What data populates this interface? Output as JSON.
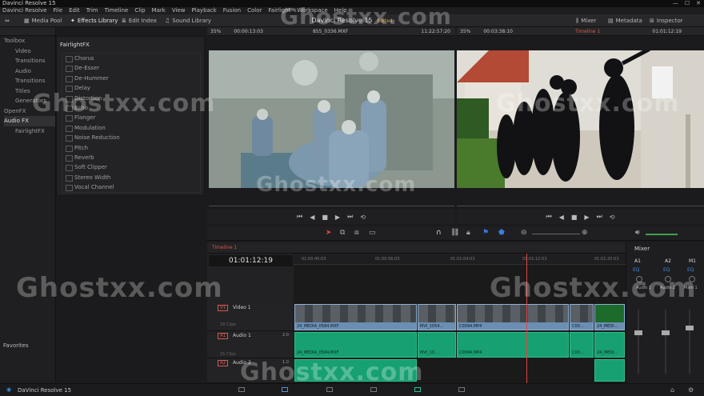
{
  "window": {
    "title": "Davinci Resolve 15",
    "controls": [
      "—",
      "☐",
      "✕"
    ]
  },
  "menu": [
    "Davinci Resolve",
    "File",
    "Edit",
    "Trim",
    "Timeline",
    "Clip",
    "Mark",
    "View",
    "Playback",
    "Fusion",
    "Color",
    "Fairlight",
    "Workspace",
    "Help"
  ],
  "toolbar": {
    "media_pool": "Media Pool",
    "effects_library": "Effects Library",
    "edit_index": "Edit Index",
    "sound_library": "Sound Library",
    "project_title": "Davinci Resolve 15",
    "edited": "Edited",
    "mixer": "Mixer",
    "metadata": "Metadata",
    "inspector": "Inspector"
  },
  "sidebar": {
    "toolbox": "Toolbox",
    "items": [
      "Video Transitions",
      "Audio Transitions",
      "Titles",
      "Generators",
      "OpenFX"
    ],
    "audio_fx": "Audio FX",
    "fairlight": "FairlightFX",
    "favorites": "Favorites"
  },
  "fx_panel": {
    "title": "FairlightFX",
    "items": [
      "Chorus",
      "De-Esser",
      "De-Hummer",
      "Delay",
      "Distortion",
      "Echo",
      "Flanger",
      "Modulation",
      "Noise Reduction",
      "Pitch",
      "Reverb",
      "Soft Clipper",
      "Stereo Width",
      "Vocal Channel"
    ]
  },
  "source_viewer": {
    "zoom": "35%",
    "duration": "00:00:13:03",
    "clip": "855_0336.MXF",
    "timecode": "11:22:57:20"
  },
  "timeline_viewer": {
    "zoom": "35%",
    "duration": "00:03:38:10",
    "name": "Timeline 1",
    "timecode": "01:01:12:19"
  },
  "timeline": {
    "tab": "Timeline 1",
    "timecode": "01:01:12:19",
    "ruler": [
      "01:00:45:03",
      "01:00:56:03",
      "01:01:04:03",
      "01:01:12:03",
      "01:01:20:03"
    ]
  },
  "tracks": [
    {
      "tag": "V1",
      "name": "Video 1",
      "clips_count": "18 Clips"
    },
    {
      "tag": "A1",
      "name": "Audio 1",
      "level": "2.0",
      "clips_count": "15 Clips"
    },
    {
      "tag": "A2",
      "name": "Audio 2",
      "level": "1.0"
    }
  ],
  "clips": {
    "video": [
      "24_MEDIA_0584.MXF",
      "MVI_1054...",
      "C0094.MP4",
      "C00...",
      "24_MEDI..."
    ],
    "audio": [
      "24_MEDIA_0584.MXF",
      "MVI_10...",
      "C0094.MP4",
      "C00...",
      "24_MEDI..."
    ]
  },
  "mixer": {
    "title": "Mixer",
    "channels": [
      "A1",
      "A2",
      "M1"
    ],
    "eq": "EQ",
    "track_labels": [
      "Audio 1",
      "Audio 2",
      "Main 1"
    ]
  },
  "watermark": "Ghostxx.com",
  "bottom": {
    "app": "DaVinci Resolve 15"
  }
}
